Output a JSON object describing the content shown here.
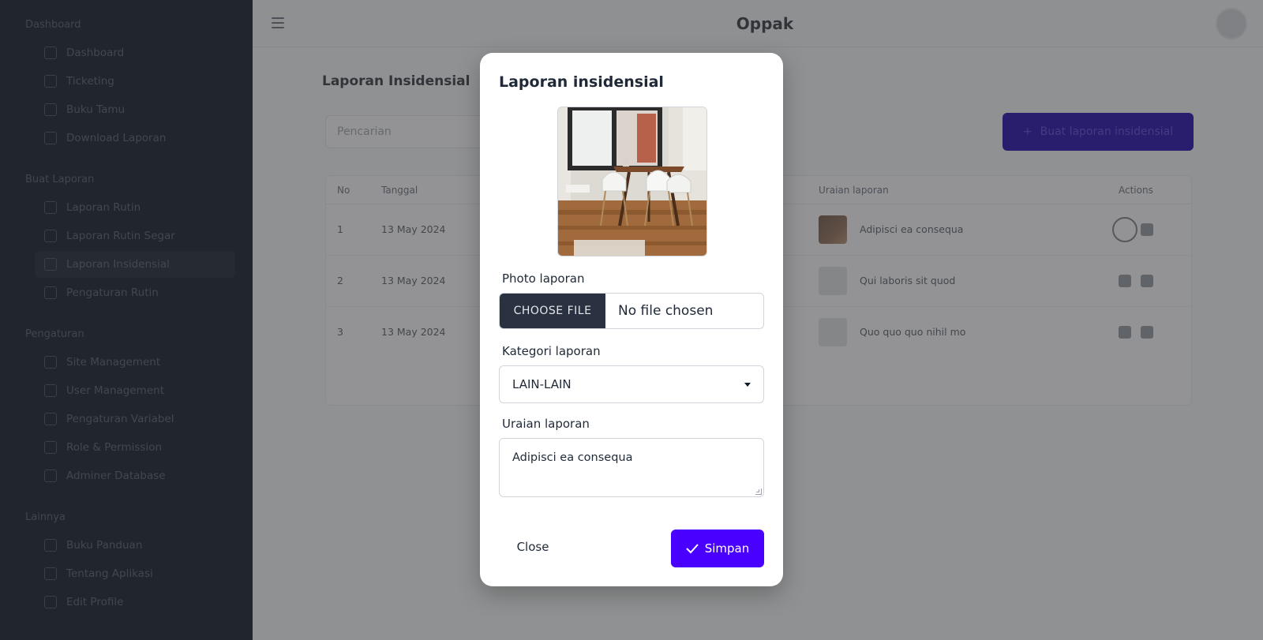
{
  "app": {
    "brand": "Oppak"
  },
  "sidebar": {
    "sections": [
      {
        "title": "Dashboard",
        "items": [
          {
            "label": "Dashboard",
            "icon": "grid-icon"
          },
          {
            "label": "Ticketing",
            "icon": "ticket-icon"
          },
          {
            "label": "Buku Tamu",
            "icon": "book-icon"
          },
          {
            "label": "Download Laporan",
            "icon": "download-icon"
          }
        ]
      },
      {
        "title": "Buat Laporan",
        "items": [
          {
            "label": "Laporan Rutin",
            "icon": "document-icon"
          },
          {
            "label": "Laporan Rutin Segar",
            "icon": "document-icon"
          },
          {
            "label": "Laporan Insidensial",
            "icon": "document-icon",
            "active": true
          },
          {
            "label": "Pengaturan Rutin",
            "icon": "list-icon"
          }
        ]
      },
      {
        "title": "Pengaturan",
        "items": [
          {
            "label": "Site Management",
            "icon": "building-icon"
          },
          {
            "label": "User Management",
            "icon": "users-icon"
          },
          {
            "label": "Pengaturan Variabel",
            "icon": "settings-icon"
          },
          {
            "label": "Role & Permission",
            "icon": "key-icon"
          },
          {
            "label": "Adminer Database",
            "icon": "database-icon"
          }
        ]
      },
      {
        "title": "Lainnya",
        "items": [
          {
            "label": "Buku Panduan",
            "icon": "book-icon"
          },
          {
            "label": "Tentang Aplikasi",
            "icon": "info-icon"
          },
          {
            "label": "Edit Profile",
            "icon": "user-icon"
          }
        ]
      }
    ]
  },
  "main": {
    "title": "Laporan Insidensial",
    "search_placeholder": "Pencarian",
    "add_button": "Buat laporan insidensial",
    "table": {
      "headers": {
        "no": "No",
        "date": "Tanggal",
        "desc": "Uraian laporan",
        "actions": "Actions"
      },
      "rows": [
        {
          "no": "1",
          "date": "13 May 2024",
          "desc": "Adipisci ea consequa",
          "has_image": true
        },
        {
          "no": "2",
          "date": "13 May 2024",
          "desc": "Qui laboris sit quod",
          "has_image": false
        },
        {
          "no": "3",
          "date": "13 May 2024",
          "desc": "Quo quo quo nihil mo",
          "has_image": false
        }
      ]
    }
  },
  "modal": {
    "title": "Laporan insidensial",
    "photo_label": "Photo laporan",
    "file_button": "CHOOSE FILE",
    "file_status": "No file chosen",
    "category_label": "Kategori laporan",
    "category_value": "LAIN-LAIN",
    "description_label": "Uraian laporan",
    "description_value": "Adipisci ea consequa",
    "close_button": "Close",
    "save_button": "Simpan"
  },
  "colors": {
    "primary": "#4a00ff",
    "sidebar": "#1c2330",
    "file_button": "#2a3140"
  }
}
